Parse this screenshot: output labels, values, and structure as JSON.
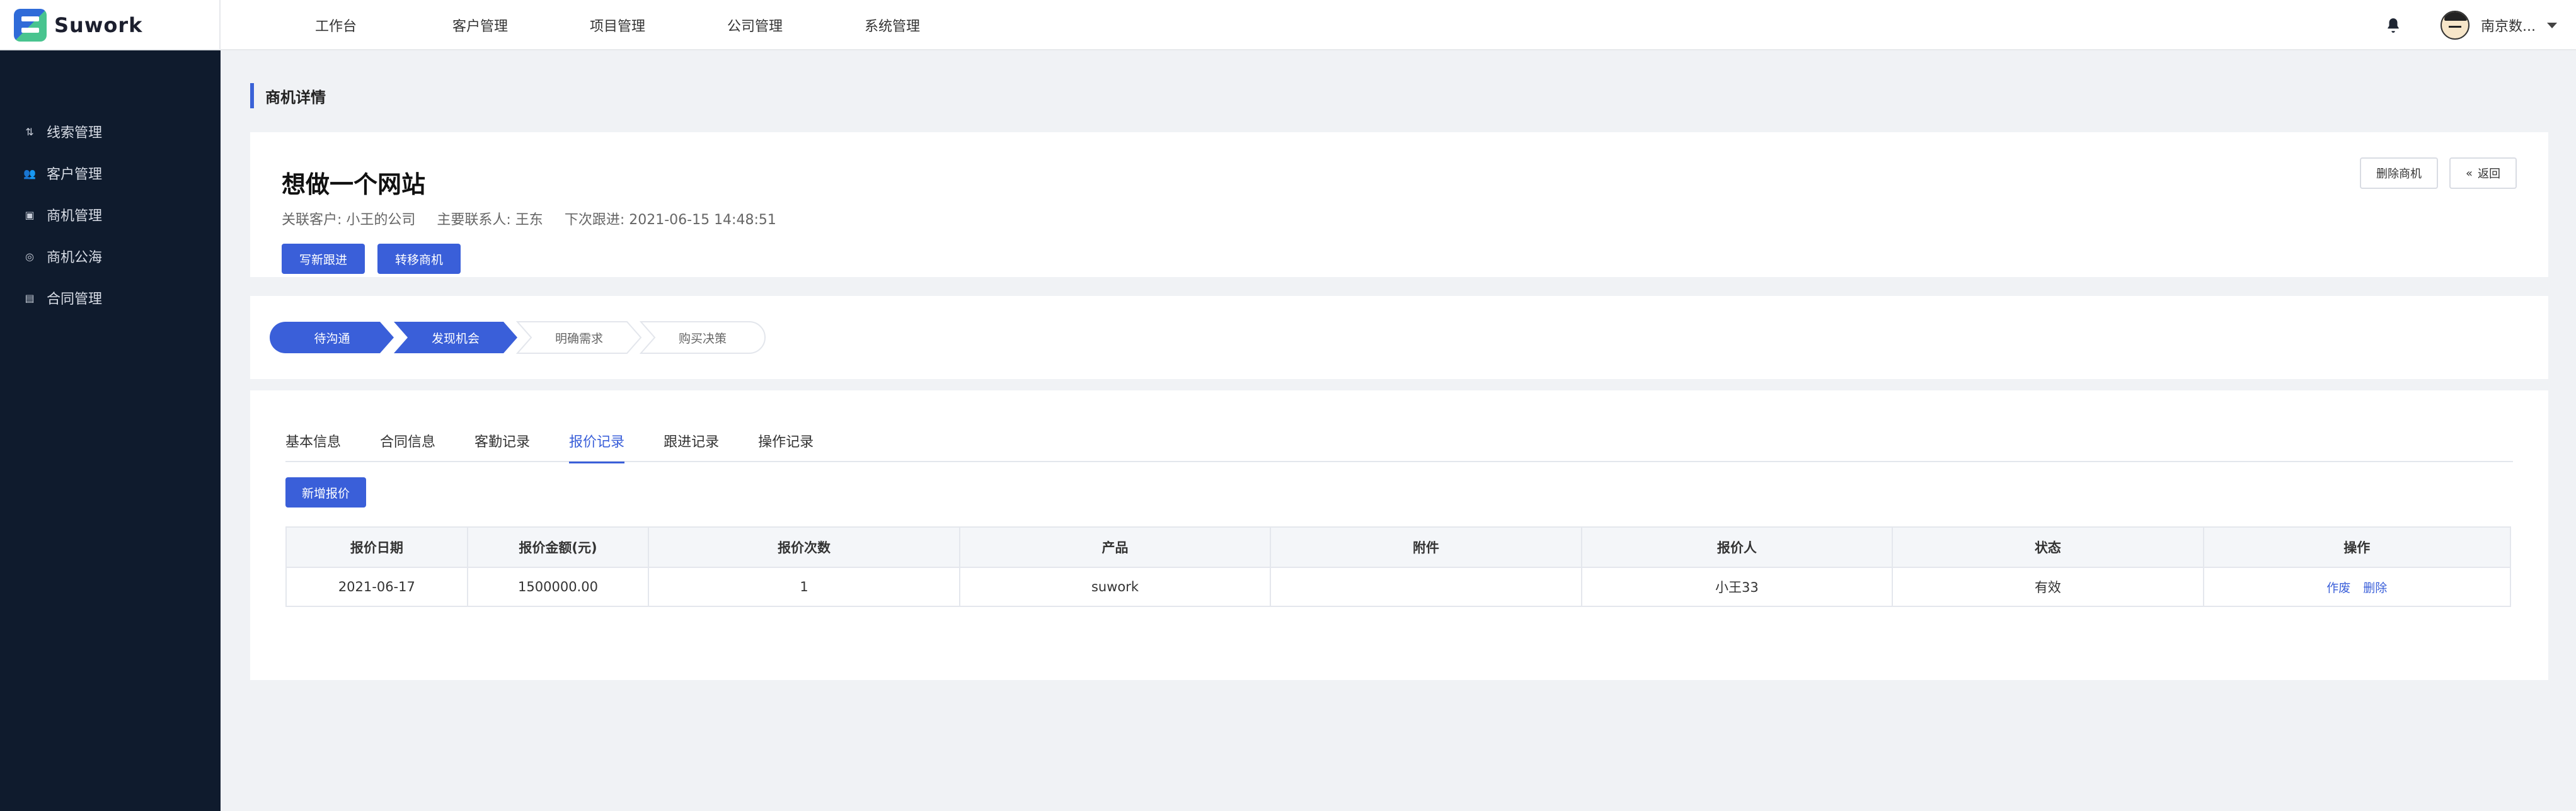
{
  "brand": {
    "name": "Suwork"
  },
  "topnav": [
    "工作台",
    "客户管理",
    "项目管理",
    "公司管理",
    "系统管理"
  ],
  "user": {
    "name": "南京数..."
  },
  "sidebar": [
    {
      "label": "线索管理",
      "icon": "clue-icon"
    },
    {
      "label": "客户管理",
      "icon": "customer-icon"
    },
    {
      "label": "商机管理",
      "icon": "briefcase-icon"
    },
    {
      "label": "商机公海",
      "icon": "pool-icon"
    },
    {
      "label": "合同管理",
      "icon": "contract-icon"
    }
  ],
  "page": {
    "title": "商机详情"
  },
  "deal": {
    "title": "想做一个网站",
    "customer": "关联客户: 小王的公司",
    "contact": "主要联系人: 王东",
    "next_followup": "下次跟进: 2021-06-15 14:48:51",
    "btn_write": "写新跟进",
    "btn_transfer": "转移商机",
    "btn_delete": "删除商机",
    "btn_back": "返回"
  },
  "steps": [
    {
      "label": "待沟通",
      "state": "done"
    },
    {
      "label": "发现机会",
      "state": "active"
    },
    {
      "label": "明确需求",
      "state": "todo"
    },
    {
      "label": "购买决策",
      "state": "todo"
    }
  ],
  "tabs": [
    "基本信息",
    "合同信息",
    "客勤记录",
    "报价记录",
    "跟进记录",
    "操作记录"
  ],
  "active_tab": "报价记录",
  "add_quote": "新增报价",
  "table": {
    "headers": [
      "报价日期",
      "报价金额(元)",
      "报价次数",
      "产品",
      "附件",
      "报价人",
      "状态",
      "操作"
    ],
    "rows": [
      {
        "date": "2021-06-17",
        "amount": "1500000.00",
        "count": "1",
        "product": "suwork",
        "attachment": "",
        "person": "小王33",
        "status": "有效",
        "action_void": "作废",
        "action_delete": "删除"
      }
    ]
  },
  "colors": {
    "primary": "#3a5fd9",
    "sidebar_bg": "#0f1b2d",
    "page_bg": "#f0f2f5"
  }
}
